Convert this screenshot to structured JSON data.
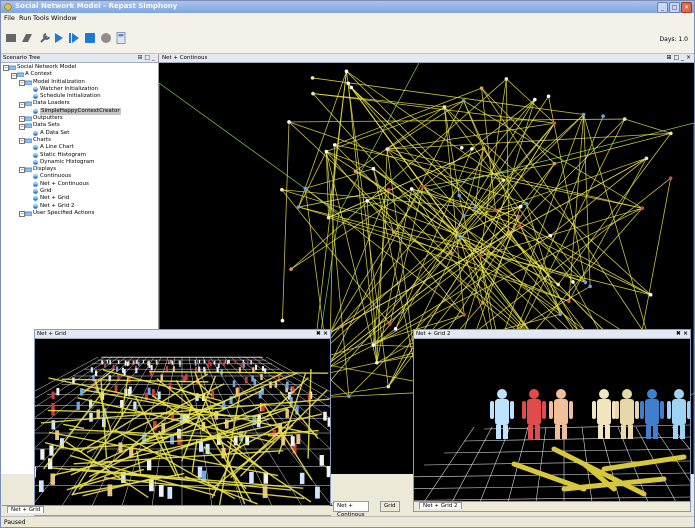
{
  "window": {
    "title": "Social Network Model - Repast Simphony",
    "buttons": [
      "_",
      "□",
      "✕"
    ]
  },
  "menu": [
    "File",
    "Run",
    "Tools",
    "Window"
  ],
  "toolbar": {
    "days_label": "Days: 1.0",
    "icons": [
      "init-icon",
      "reset-icon",
      "wrench-icon",
      "play-icon",
      "step-icon",
      "stop-icon",
      "record-icon",
      "calc-icon"
    ]
  },
  "scenario_tree": {
    "title": "Scenario Tree",
    "controls": "⊞ □ _",
    "items": [
      {
        "label": "Social Network Model",
        "depth": 0
      },
      {
        "label": "A Context",
        "depth": 1
      },
      {
        "label": "Model Initialization",
        "depth": 2
      },
      {
        "label": "Watcher Initialization",
        "depth": 3
      },
      {
        "label": "Schedule Initialization",
        "depth": 3
      },
      {
        "label": "Data Loaders",
        "depth": 2
      },
      {
        "label": "SimpleHappyContextCreator",
        "depth": 3,
        "selected": true
      },
      {
        "label": "Outputters",
        "depth": 2
      },
      {
        "label": "Data Sets",
        "depth": 2
      },
      {
        "label": "A Data Set",
        "depth": 3
      },
      {
        "label": "Charts",
        "depth": 2
      },
      {
        "label": "A Line Chart",
        "depth": 3
      },
      {
        "label": "Static Histogram",
        "depth": 3
      },
      {
        "label": "Dynamic Histogram",
        "depth": 3
      },
      {
        "label": "Displays",
        "depth": 2
      },
      {
        "label": "Continuous",
        "depth": 3
      },
      {
        "label": "Net + Continuous",
        "depth": 3
      },
      {
        "label": "Grid",
        "depth": 3
      },
      {
        "label": "Net + Grid",
        "depth": 3
      },
      {
        "label": "Net + Grid 2",
        "depth": 3
      },
      {
        "label": "User Specified Actions",
        "depth": 2
      }
    ]
  },
  "main_display": {
    "title": "Net + Continous",
    "controls": "⊞ □ _ ×"
  },
  "net_grid_window": {
    "title": "Net + Grid",
    "close": "✖ ×",
    "tab_label": "Net + Grid"
  },
  "net_grid2_window": {
    "title": "Net + Grid 2",
    "close": "✖ ×",
    "tab_label": "Net + Grid 2"
  },
  "bottom_tabs": [
    "Net + Continous",
    "Grid"
  ],
  "bottom_tab_partial": "us",
  "status": {
    "text": "Paused"
  },
  "colors": {
    "titlebar": "#7fa4de",
    "link_yellow": "#e8e24a",
    "box_green": "#7bd15a",
    "grid_white": "#dddddd"
  }
}
